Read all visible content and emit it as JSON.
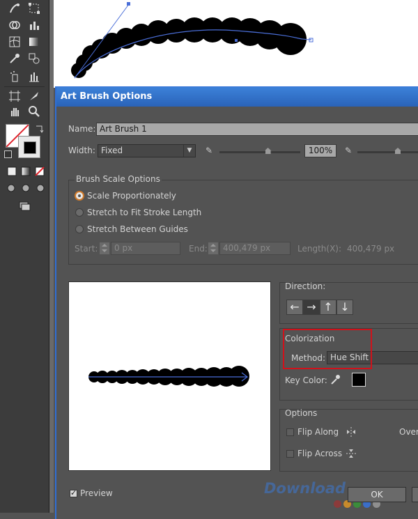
{
  "dialog": {
    "title": "Art Brush Options",
    "name_label": "Name:",
    "name_value": "Art Brush 1",
    "width_label": "Width:",
    "width_value": "Fixed",
    "width_percent": "100%",
    "width_slider_level_percent": 60
  },
  "brush_scale": {
    "title": "Brush Scale Options",
    "options": [
      "Scale Proportionately",
      "Stretch to Fit Stroke Length",
      "Stretch Between Guides"
    ],
    "selected": "Scale Proportionately",
    "start_label": "Start:",
    "start_value": "0 px",
    "end_label": "End:",
    "end_value": "400,479 px",
    "length_label": "Length(X):",
    "length_value": "400,479 px"
  },
  "direction": {
    "title": "Direction:",
    "buttons": [
      "←",
      "→",
      "↑",
      "↓"
    ],
    "selected": "→"
  },
  "colorization": {
    "title": "Colorization",
    "method_label": "Method:",
    "method_value": "Hue Shift",
    "key_color_label": "Key Color:",
    "key_color": "#000000",
    "highlight_color": "#d0121b"
  },
  "options": {
    "title": "Options",
    "flip_along": "Flip Along",
    "flip_across": "Flip Across",
    "overlap_partial": "Overl"
  },
  "footer": {
    "preview_label": "Preview",
    "preview_checked": true,
    "ok_label": "OK"
  },
  "watermark": "Download"
}
